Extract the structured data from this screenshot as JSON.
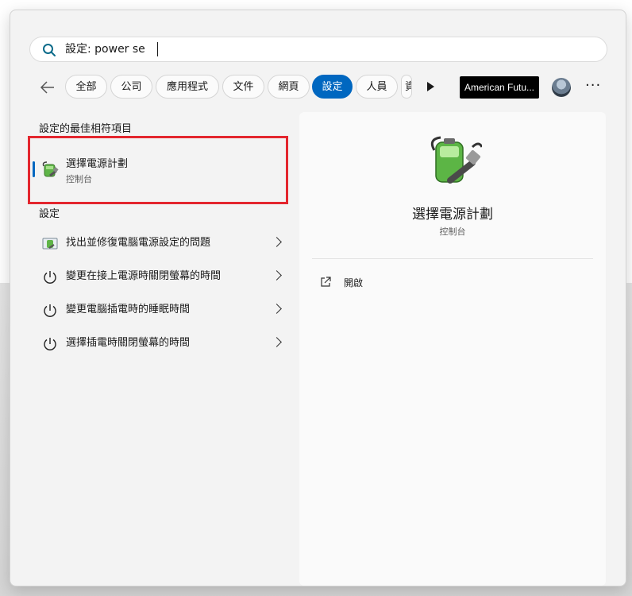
{
  "search": {
    "value": "設定: power se"
  },
  "filters": [
    "全部",
    "公司",
    "應用程式",
    "文件",
    "網頁",
    "設定",
    "人員",
    "資"
  ],
  "active_filter": "設定",
  "promo": {
    "label": "American Futu..."
  },
  "sections": {
    "best_match_title": "設定的最佳相符項目",
    "settings_title": "設定"
  },
  "best_match": {
    "title": "選擇電源計劃",
    "subtitle": "控制台"
  },
  "results": [
    {
      "label": "找出並修復電腦電源設定的問題",
      "icon": "troubleshoot-icon"
    },
    {
      "label": "變更在接上電源時關閉螢幕的時間",
      "icon": "power-icon"
    },
    {
      "label": "變更電腦插電時的睡眠時間",
      "icon": "power-icon"
    },
    {
      "label": "選擇插電時關閉螢幕的時間",
      "icon": "power-icon"
    }
  ],
  "details": {
    "title": "選擇電源計劃",
    "subtitle": "控制台",
    "actions": [
      {
        "label": "開啟",
        "icon": "open-external-icon"
      }
    ]
  },
  "colors": {
    "accent": "#0067c0",
    "highlight": "#e3262e"
  }
}
